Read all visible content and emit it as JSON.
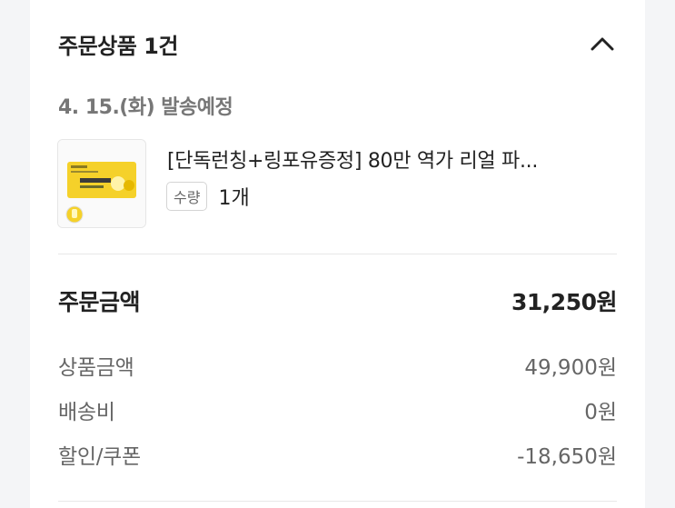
{
  "order_section": {
    "title": "주문상품 1건",
    "ship_date": "4. 15.(화) 발송예정",
    "product": {
      "name": "[단독런칭+링포유증정] 80만 역가 리얼 파...",
      "thumbnail_icon": "product-thumbnail",
      "qty_label": "수량",
      "qty_value": "1개"
    }
  },
  "summary": {
    "total_label": "주문금액",
    "total_value": "31,250원",
    "items": [
      {
        "label": "상품금액",
        "value": "49,900원"
      },
      {
        "label": "배송비",
        "value": "0원"
      },
      {
        "label": "할인/쿠폰",
        "value": "-18,650원"
      }
    ]
  },
  "colors": {
    "background": "#f4f5f7",
    "card": "#ffffff",
    "thumbnail_accent": "#f5d12a"
  }
}
